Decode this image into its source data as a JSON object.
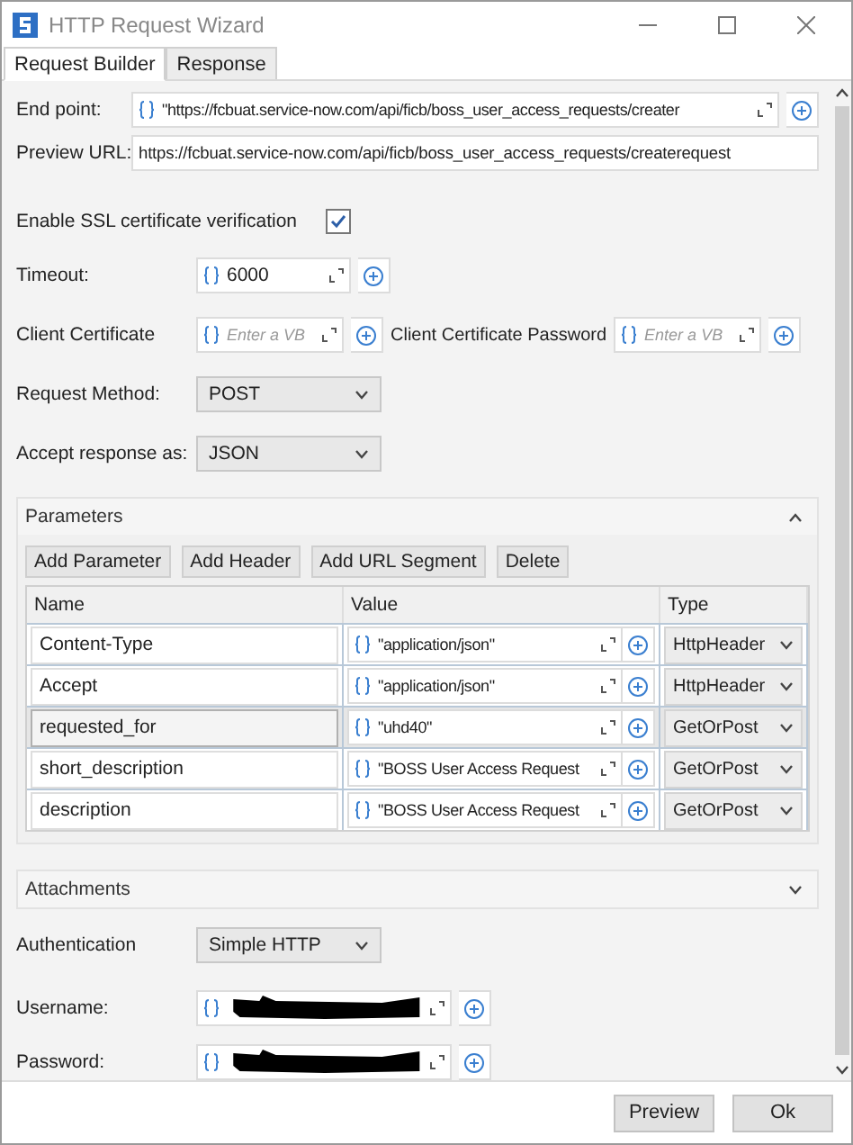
{
  "window": {
    "title": "HTTP Request Wizard"
  },
  "tabs": [
    {
      "label": "Request Builder",
      "selected": true
    },
    {
      "label": "Response",
      "selected": false
    }
  ],
  "endpoint": {
    "label": "End point:",
    "value": "\"https://fcbuat.service-now.com/api/ficb/boss_user_access_requests/creater"
  },
  "preview_url": {
    "label": "Preview URL:",
    "value": "https://fcbuat.service-now.com/api/ficb/boss_user_access_requests/createrequest"
  },
  "ssl_verification": {
    "label": "Enable SSL certificate verification",
    "checked": true
  },
  "timeout": {
    "label": "Timeout:",
    "value": "6000"
  },
  "client_certificate": {
    "label": "Client Certificate",
    "placeholder": "Enter a VB"
  },
  "client_certificate_password": {
    "label": "Client Certificate Password",
    "placeholder": "Enter a VB"
  },
  "request_method": {
    "label": "Request Method:",
    "value": "POST"
  },
  "accept_response": {
    "label": "Accept response as:",
    "value": "JSON"
  },
  "parameters": {
    "title": "Parameters",
    "expanded": true,
    "buttons": [
      "Add Parameter",
      "Add Header",
      "Add URL Segment",
      "Delete"
    ],
    "columns": [
      "Name",
      "Value",
      "Type"
    ],
    "rows": [
      {
        "name": "Content-Type",
        "value": "\"application/json\"",
        "type": "HttpHeader",
        "selected": false
      },
      {
        "name": "Accept",
        "value": "\"application/json\"",
        "type": "HttpHeader",
        "selected": false
      },
      {
        "name": "requested_for",
        "value": "\"uhd40\"",
        "type": "GetOrPost",
        "selected": true
      },
      {
        "name": "short_description",
        "value": "\"BOSS User Access Request",
        "type": "GetOrPost",
        "selected": false
      },
      {
        "name": "description",
        "value": "\"BOSS User Access Request",
        "type": "GetOrPost",
        "selected": false
      }
    ]
  },
  "attachments": {
    "title": "Attachments",
    "expanded": false
  },
  "authentication": {
    "label": "Authentication",
    "value": "Simple HTTP"
  },
  "username": {
    "label": "Username:"
  },
  "password": {
    "label": "Password:"
  },
  "buttons": [
    "Preview",
    "Ok"
  ]
}
